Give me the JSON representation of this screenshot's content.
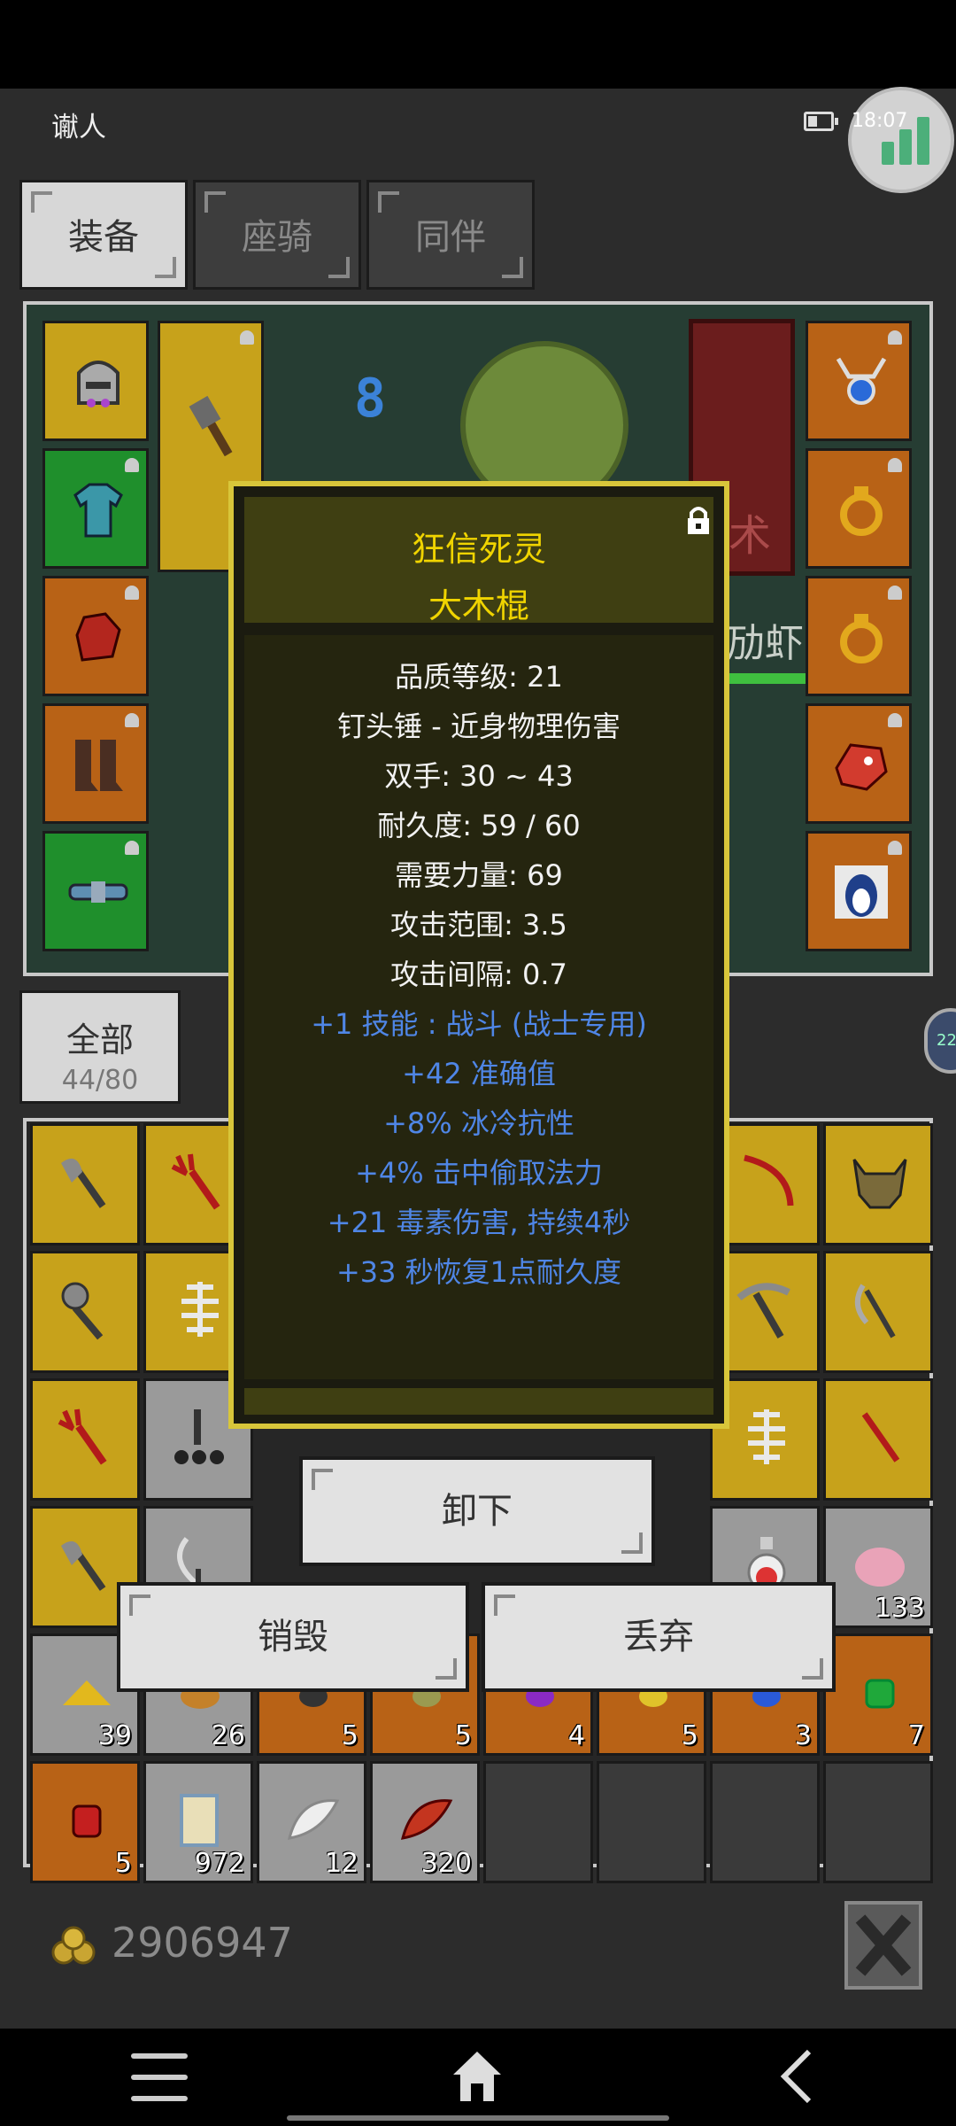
{
  "status": {
    "title": "谳人",
    "time": "18:07"
  },
  "tabs": [
    {
      "label": "装备",
      "active": true
    },
    {
      "label": "座骑",
      "active": false
    },
    {
      "label": "同伴",
      "active": false
    }
  ],
  "scene": {
    "level_number": "8",
    "sign_text": "术",
    "creature_text": "劢虾"
  },
  "filter": {
    "label": "全部",
    "count": "44/80"
  },
  "side_badge": "22",
  "tooltip": {
    "prefix_name": "狂信死灵",
    "item_name": "大木棍",
    "stats": [
      "品质等级: 21",
      "钉头锤 - 近身物理伤害",
      "双手: 30 ~ 43",
      "耐久度: 59 / 60",
      "需要力量: 69",
      "攻击范围: 3.5",
      "攻击间隔: 0.7"
    ],
    "affixes": [
      "+1 技能 : 战斗 (战士专用)",
      "+42 准确值",
      "+8% 冰冷抗性",
      "+4% 击中偷取法力",
      "+21 毒素伤害, 持续4秒",
      "+33 秒恢复1点耐久度"
    ]
  },
  "actions": {
    "unequip": "卸下",
    "destroy": "销毁",
    "discard": "丢弃"
  },
  "inventory_counts": {
    "row5": [
      "39",
      "26",
      "5",
      "5",
      "4",
      "5",
      "3",
      "7"
    ],
    "row4_last": "133",
    "row6": [
      "5",
      "972",
      "12",
      "320"
    ]
  },
  "gold": "2906947",
  "colors": {
    "tooltip_border": "#d8c63a",
    "tooltip_title": "#f0d400",
    "affix_blue": "#4f86e6",
    "slot_yellow": "#c7a21b",
    "slot_green": "#1f8f2c",
    "slot_orange": "#b86216"
  },
  "icons": [
    "battery-icon",
    "signal-widget-icon",
    "lock-icon",
    "gold-coins-icon",
    "close-icon",
    "menu-icon",
    "home-icon",
    "back-icon"
  ]
}
